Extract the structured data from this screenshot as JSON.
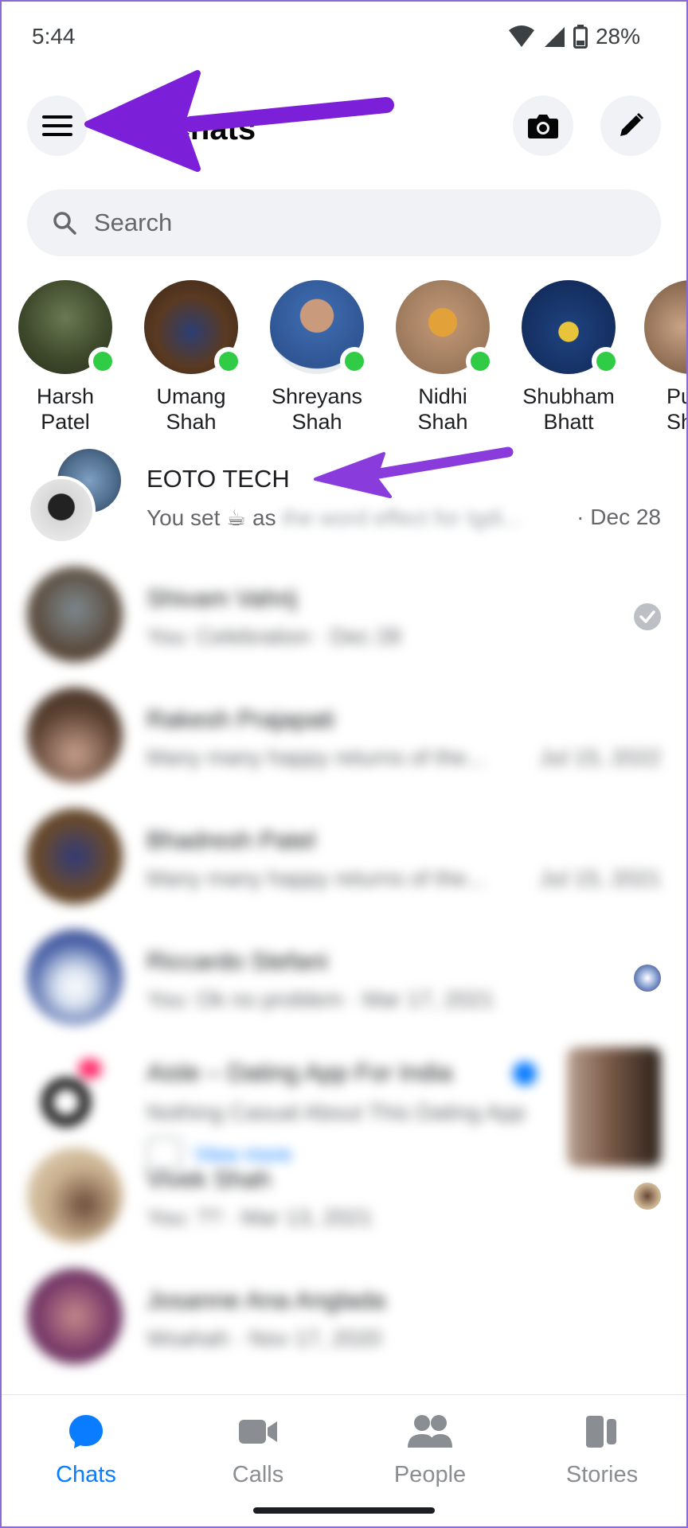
{
  "status_bar": {
    "time": "5:44",
    "battery": "28%"
  },
  "header": {
    "title": "Chats"
  },
  "search": {
    "placeholder": "Search"
  },
  "stories": [
    {
      "name": "Harsh\nPatel"
    },
    {
      "name": "Umang\nShah"
    },
    {
      "name": "Shreyans\nShah"
    },
    {
      "name": "Nidhi\nShah"
    },
    {
      "name": "Shubham\nBhatt"
    },
    {
      "name": "Pu\nSh"
    }
  ],
  "chats": [
    {
      "name": "EOTO TECH",
      "preview_prefix": "You set ☕ as",
      "preview_blurred": "the word effect for Igdi...",
      "time": "· Dec 28"
    },
    {
      "name": "Shivam Vahrij",
      "preview": "You: Celebration · Dec 28"
    },
    {
      "name": "Rakesh Prajapati",
      "preview": "Many many happy returns of the...",
      "time": "Jul 15, 2022"
    },
    {
      "name": "Bhadresh Patel",
      "preview": "Many many happy returns of the...",
      "time": "Jul 15, 2021"
    },
    {
      "name": "Riccardo Stefani",
      "preview": "You: Ok no problem · Mar 17, 2021"
    },
    {
      "name": "Aisle – Dating App For India",
      "preview": "Nothing Casual About This Dating App",
      "link": "View more"
    },
    {
      "name": "Vivek Shah",
      "preview": "You: ?? · Mar 13, 2021"
    },
    {
      "name": "Josanne Ana Anglada",
      "preview": "Woahah · Nov 17, 2020"
    }
  ],
  "bottom_nav": [
    {
      "label": "Chats",
      "active": true
    },
    {
      "label": "Calls"
    },
    {
      "label": "People"
    },
    {
      "label": "Stories"
    }
  ],
  "colors": {
    "accent": "#0a7cff",
    "online": "#31cc46",
    "annotation": "#7b1fd9"
  }
}
